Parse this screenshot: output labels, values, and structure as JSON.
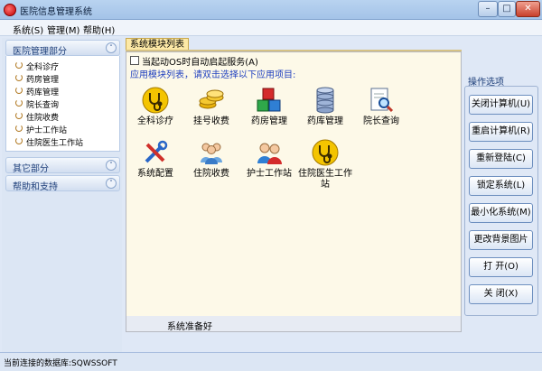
{
  "window": {
    "title": "医院信息管理系统",
    "min_label": "–",
    "max_label": "□",
    "close_label": "✕"
  },
  "menu": [
    {
      "label": "系统(S)"
    },
    {
      "label": "管理(M)"
    },
    {
      "label": "帮助(H)"
    }
  ],
  "sidebar": {
    "section_main": {
      "title": "医院管理部分",
      "chevron": "˄"
    },
    "items": [
      {
        "label": "全科诊疗"
      },
      {
        "label": "药房管理"
      },
      {
        "label": "药库管理"
      },
      {
        "label": "院长查询"
      },
      {
        "label": "住院收费"
      },
      {
        "label": "护士工作站"
      },
      {
        "label": "住院医生工作站"
      }
    ],
    "section_other": {
      "title": "其它部分",
      "chevron": "˅"
    },
    "section_help": {
      "title": "帮助和支持",
      "chevron": "˅"
    }
  },
  "tab": {
    "label": "系统模块列表"
  },
  "autostart": {
    "label": "当起动OS时自动启起服务(A)",
    "checked": false
  },
  "hint": "应用模块列表，请双击选择以下应用项目:",
  "modules": [
    {
      "label": "全科诊疗",
      "icon": "stethoscope-icon"
    },
    {
      "label": "挂号收费",
      "icon": "coins-icon"
    },
    {
      "label": "药房管理",
      "icon": "cubes-icon"
    },
    {
      "label": "药库管理",
      "icon": "database-icon"
    },
    {
      "label": "院长查询",
      "icon": "search-document-icon"
    },
    {
      "label": "系统配置",
      "icon": "tools-icon"
    },
    {
      "label": "住院收费",
      "icon": "users-icon"
    },
    {
      "label": "护士工作站",
      "icon": "nurse-icon"
    },
    {
      "label": "住院医生工作站",
      "icon": "stethoscope-icon"
    }
  ],
  "status_message": "系统准备好",
  "ops": {
    "title": "操作选项",
    "buttons": [
      {
        "label": "关闭计算机(U)"
      },
      {
        "label": "重启计算机(R)"
      },
      {
        "label": "重新登陆(C)"
      },
      {
        "label": "锁定系统(L)"
      },
      {
        "label": "最小化系统(M)"
      },
      {
        "label": "更改背景图片"
      },
      {
        "label": "打 开(O)"
      },
      {
        "label": "关 闭(X)"
      }
    ]
  },
  "statusbar": {
    "text": "当前连接的数据库:SQWSSOFT"
  },
  "colors": {
    "accent": "#1f3fbf",
    "tab": "#fde9a6",
    "content_bg": "#fdf9e8"
  }
}
